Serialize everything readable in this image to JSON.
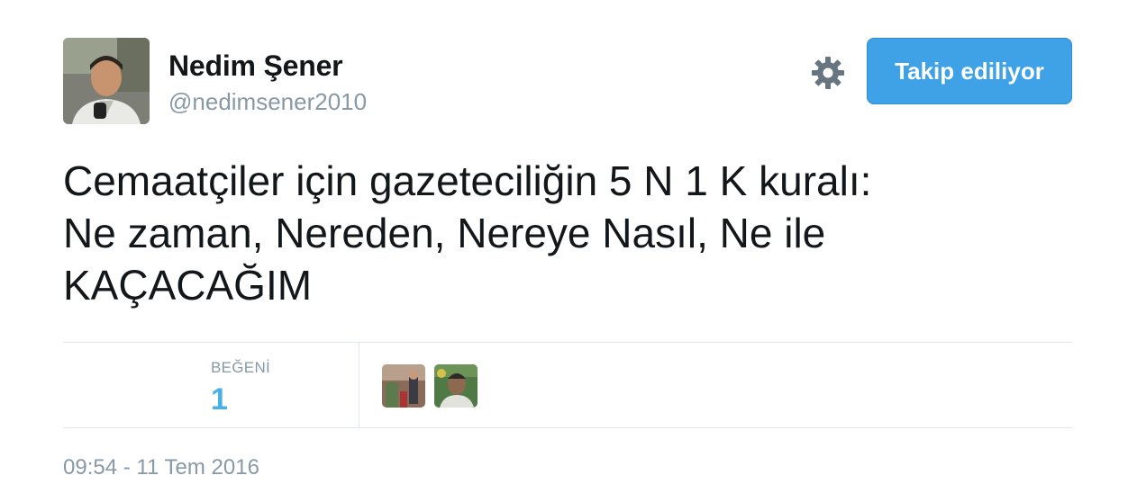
{
  "user": {
    "name": "Nedim Şener",
    "handle": "@nedimsener2010",
    "follow_label": "Takip ediliyor"
  },
  "tweet": {
    "text": "Cemaatçiler için gazeteciliğin 5 N 1 K kuralı:\nNe zaman, Nereden, Nereye Nasıl, Ne ile\nKAÇACAĞIM",
    "likes_label": "BEĞENİ",
    "likes_count": "1",
    "timestamp": "09:54 - 11 Tem 2016"
  },
  "colors": {
    "follow_button": "#3fa1e6",
    "like_count": "#47b0e6",
    "secondary_text": "#8899a6"
  },
  "icons": {
    "settings": "gear-icon"
  }
}
